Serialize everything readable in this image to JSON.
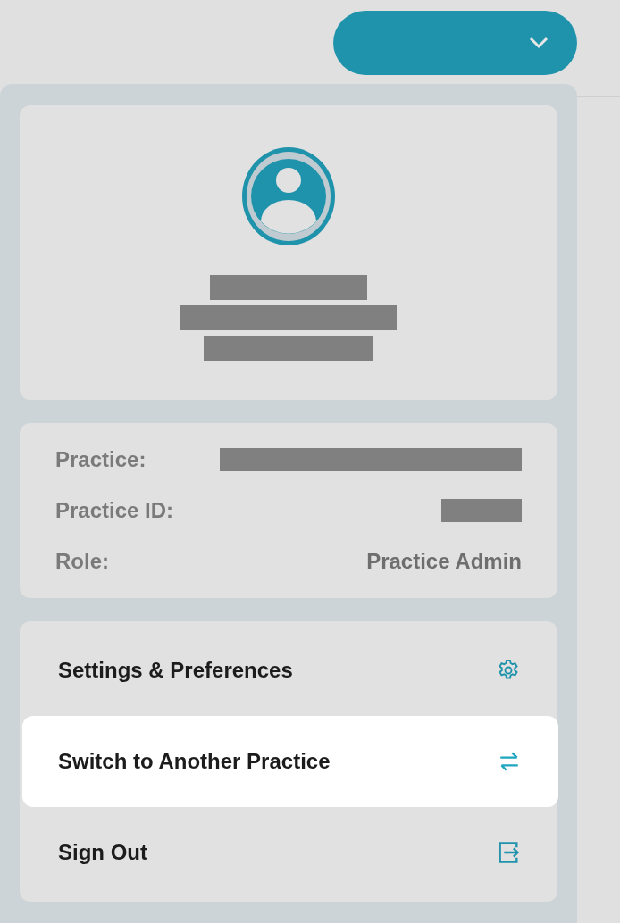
{
  "account_button": {
    "expanded": true
  },
  "details": [
    {
      "label": "Practice:",
      "kind": "redacted"
    },
    {
      "label": "Practice ID:",
      "kind": "redacted"
    },
    {
      "label": "Role:",
      "kind": "text",
      "value": "Practice Admin"
    }
  ],
  "menu": [
    {
      "label": "Settings & Preferences",
      "selected": false
    },
    {
      "label": "Switch to Another Practice",
      "selected": true
    },
    {
      "label": "Sign Out",
      "selected": false
    }
  ]
}
